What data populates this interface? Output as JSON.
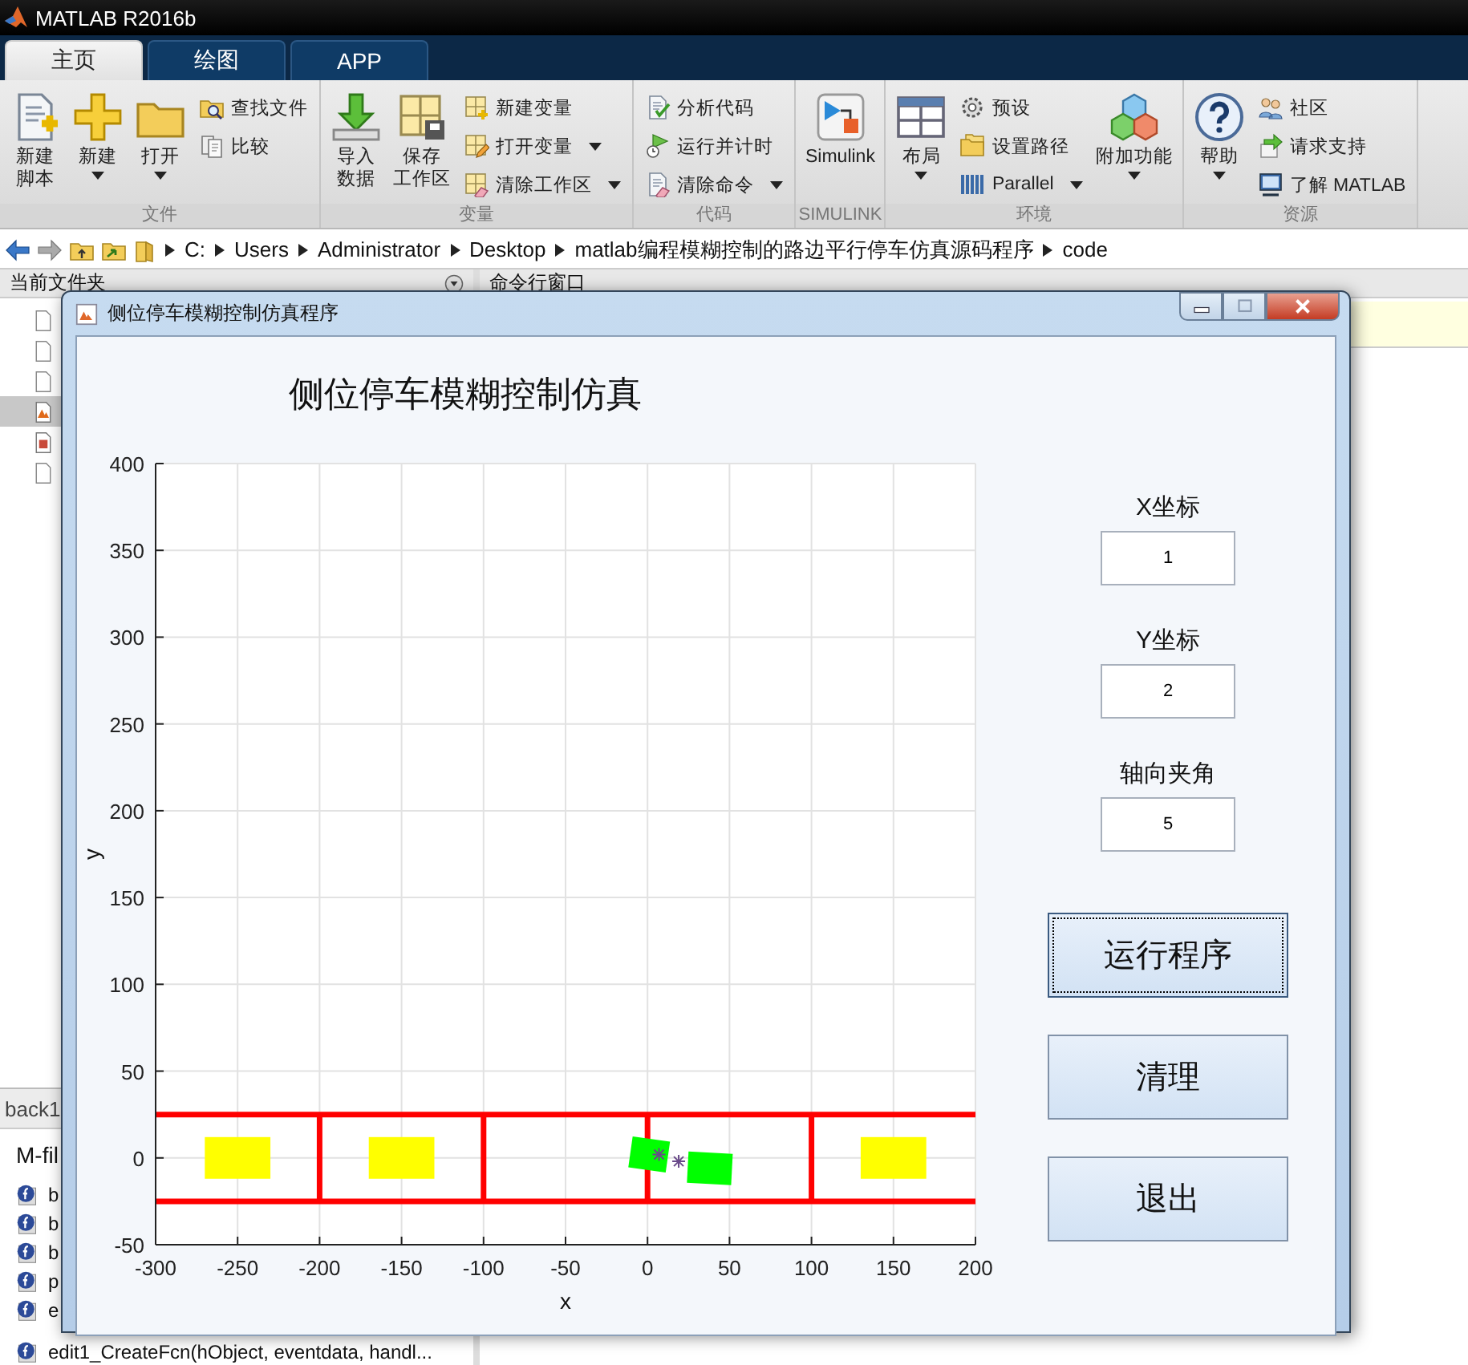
{
  "app": {
    "title": "MATLAB R2016b"
  },
  "tabs": [
    {
      "label": "主页",
      "selected": true
    },
    {
      "label": "绘图",
      "selected": false
    },
    {
      "label": "APP",
      "selected": false
    }
  ],
  "ribbon": {
    "sections": [
      {
        "label": "文件",
        "items": [
          {
            "kind": "large",
            "label": "新建脚本",
            "dropdown": false
          },
          {
            "kind": "large",
            "label": "新建",
            "dropdown": true
          },
          {
            "kind": "large",
            "label": "打开",
            "dropdown": true
          },
          {
            "kind": "stack",
            "items": [
              {
                "label": "查找文件",
                "dropdown": false
              },
              {
                "label": "比较",
                "dropdown": false
              }
            ]
          }
        ]
      },
      {
        "label": "变量",
        "items": [
          {
            "kind": "large",
            "label": "导入数据",
            "dropdown": false
          },
          {
            "kind": "large",
            "label": "保存工作区",
            "dropdown": false
          },
          {
            "kind": "stack",
            "items": [
              {
                "label": "新建变量",
                "dropdown": false
              },
              {
                "label": "打开变量",
                "dropdown": true
              },
              {
                "label": "清除工作区",
                "dropdown": true
              }
            ]
          }
        ]
      },
      {
        "label": "代码",
        "items": [
          {
            "kind": "stack",
            "items": [
              {
                "label": "分析代码",
                "dropdown": false
              },
              {
                "label": "运行并计时",
                "dropdown": false
              },
              {
                "label": "清除命令",
                "dropdown": true
              }
            ]
          }
        ]
      },
      {
        "label": "SIMULINK",
        "items": [
          {
            "kind": "large",
            "label": "Simulink",
            "dropdown": false
          }
        ]
      },
      {
        "label": "环境",
        "items": [
          {
            "kind": "large",
            "label": "布局",
            "dropdown": true
          },
          {
            "kind": "stack",
            "items": [
              {
                "label": "预设",
                "dropdown": false
              },
              {
                "label": "设置路径",
                "dropdown": false
              },
              {
                "label": "Parallel",
                "dropdown": true
              }
            ]
          },
          {
            "kind": "large",
            "label": "附加功能",
            "dropdown": true
          }
        ]
      },
      {
        "label": "资源",
        "items": [
          {
            "kind": "large",
            "label": "帮助",
            "dropdown": true
          },
          {
            "kind": "stack",
            "items": [
              {
                "label": "社区",
                "dropdown": false
              },
              {
                "label": "请求支持",
                "dropdown": false
              },
              {
                "label": "了解 MATLAB",
                "dropdown": false
              }
            ]
          }
        ]
      }
    ]
  },
  "address_bar": {
    "path": [
      "C:",
      "Users",
      "Administrator",
      "Desktop",
      "matlab编程模糊控制的路边平行停车仿真源码程序",
      "code"
    ]
  },
  "current_folder": {
    "title": "当前文件夹",
    "files": [
      {
        "selected": false
      },
      {
        "selected": false
      },
      {
        "selected": false
      },
      {
        "selected": true
      },
      {
        "selected": false
      },
      {
        "selected": false
      }
    ]
  },
  "details": {
    "tab": "back1",
    "heading": "M-fil",
    "functions": [
      "b",
      "b",
      "b",
      "p",
      "e",
      "edit1_CreateFcn(hObject, eventdata, handl..."
    ]
  },
  "command_window": {
    "title": "命令行窗口"
  },
  "figure": {
    "title": "侧位停车模糊控制仿真程序",
    "chart_data": {
      "type": "line",
      "title": "侧位停车模糊控制仿真",
      "xlabel": "x",
      "ylabel": "y",
      "xlim": [
        -300,
        200
      ],
      "ylim": [
        -50,
        400
      ],
      "grid": true,
      "xticks": [
        -300,
        -250,
        -200,
        -150,
        -100,
        -50,
        0,
        50,
        100,
        150,
        200
      ],
      "yticks": [
        -50,
        0,
        50,
        100,
        150,
        200,
        250,
        300,
        350,
        400
      ],
      "x": [
        -300,
        200
      ],
      "series": [
        {
          "color": "#ff0000",
          "values": [
            25,
            25
          ]
        },
        {
          "color": "#ff0000",
          "values": [
            -25,
            -25
          ]
        }
      ]
    },
    "fields": [
      {
        "label": "X坐标",
        "value": "1"
      },
      {
        "label": "Y坐标",
        "value": "2"
      },
      {
        "label": "轴向夹角",
        "value": "5"
      }
    ],
    "buttons": [
      {
        "label": "运行程序",
        "focused": true
      },
      {
        "label": "清理",
        "focused": false
      },
      {
        "label": "退出",
        "focused": false
      }
    ]
  }
}
